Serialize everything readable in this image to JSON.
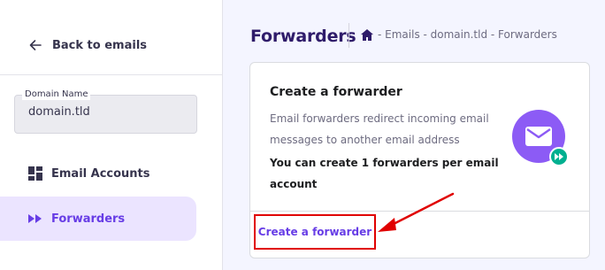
{
  "sidebar": {
    "back_label": "Back to emails",
    "domain_field": {
      "label": "Domain Name",
      "value": "domain.tld"
    },
    "items": [
      {
        "label": "Email Accounts",
        "icon": "dashboard-grid-icon",
        "active": false
      },
      {
        "label": "Forwarders",
        "icon": "fast-forward-icon",
        "active": true
      }
    ]
  },
  "header": {
    "title": "Forwarders",
    "breadcrumb": "- Emails - domain.tld - Forwarders",
    "breadcrumb_icon": "home-icon"
  },
  "card": {
    "title": "Create a forwarder",
    "description": "Email forwarders redirect incoming email messages to another email address",
    "note": "You can create 1 forwarders per email account",
    "action_label": "Create a forwarder",
    "illustration_icon": "envelope-forward-icon"
  },
  "colors": {
    "accent": "#673de6",
    "annotation": "#e00000",
    "badge": "#00b090"
  }
}
